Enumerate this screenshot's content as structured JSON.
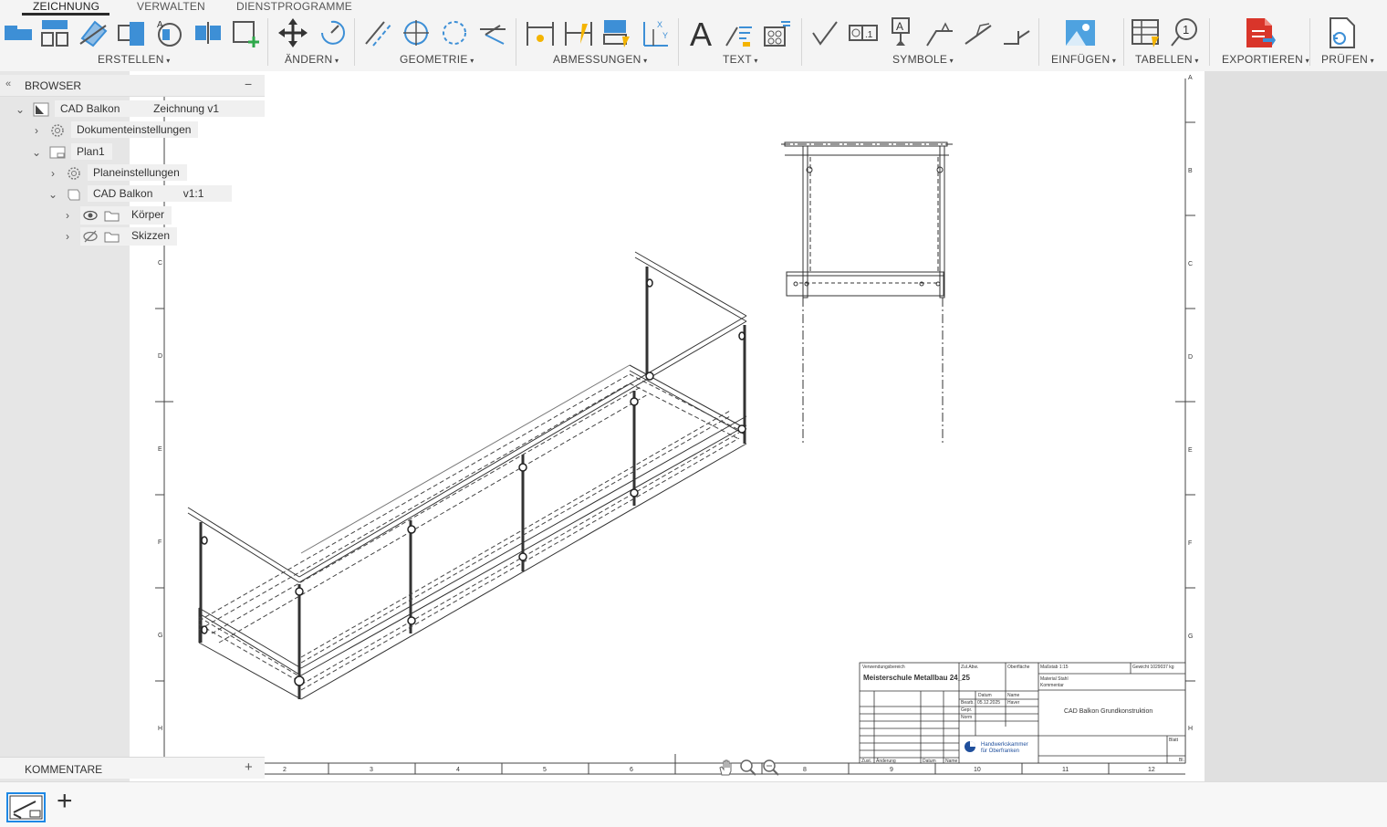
{
  "tabs": {
    "zeichnung": "ZEICHNUNG",
    "verwalten": "VERWALTEN",
    "dienstprogramme": "DIENSTPROGRAMME"
  },
  "groups": {
    "erstellen": "ERSTELLEN",
    "aendern": "ÄNDERN",
    "geometrie": "GEOMETRIE",
    "abmessungen": "ABMESSUNGEN",
    "text": "TEXT",
    "symbole": "SYMBOLE",
    "einfuegen": "EINFÜGEN",
    "tabellen": "TABELLEN",
    "exportieren": "EXPORTIEREN",
    "pruefen": "PRÜFEN"
  },
  "browser": {
    "title": "BROWSER",
    "collapse": "«",
    "minimize": "−",
    "items": [
      {
        "label": "CAD Balkon",
        "suffix": "Zeichnung v1"
      },
      {
        "label": "Dokumenteinstellungen"
      },
      {
        "label": "Plan1"
      },
      {
        "label": "Planeinstellungen"
      },
      {
        "label": "CAD Balkon",
        "suffix": "v1:1"
      },
      {
        "label": "Körper"
      },
      {
        "label": "Skizzen"
      }
    ]
  },
  "comments": {
    "label": "KOMMENTARE",
    "add": "+"
  },
  "sheet": {
    "col_labels": [
      "2",
      "3",
      "4",
      "5",
      "6",
      "8",
      "9",
      "10",
      "11",
      "12"
    ],
    "row_labels_left": [
      "C",
      "D",
      "E",
      "F",
      "G",
      "H"
    ],
    "row_labels_right": [
      "A",
      "B",
      "C",
      "D",
      "E",
      "F",
      "G",
      "H"
    ]
  },
  "title_block": {
    "verwendungsbereich": "Verwendungsbereich",
    "project": "Meisterschule Metallbau 24_25",
    "zulbw": "Zul.Abw.",
    "oberflaeche": "Oberfläche",
    "massstab": "Maßstab 1:15",
    "gewicht": "Gewicht 1029037 kg",
    "material": "Material Stahl",
    "kommentar": "Kommentar",
    "datum": "Datum",
    "name": "Name",
    "bearb": "Bearb.",
    "bearb_datum": "05.12.2025",
    "bearb_name": "Haver",
    "gepr": "Gepr.",
    "norm": "Norm",
    "drawing_title": "CAD Balkon Grundkonstruktion",
    "org_line1": "Handwerkskammer",
    "org_line2": "für Oberfranken",
    "blatt": "Blatt",
    "bl": "Bl.",
    "zust": "Zust.",
    "aenderung": "Änderung",
    "datum2": "Datum",
    "name2": "Name"
  },
  "nav_icons": [
    "pan-icon",
    "zoom-icon",
    "zoom-window-icon"
  ],
  "bottom": {
    "add": "+"
  },
  "colors": {
    "ribbon_bg": "#f4f4f4",
    "accent_blue": "#3d8fd6",
    "export_red": "#d9352a",
    "sheet_gray": "#e0e0e0",
    "line": "#3a3a3a"
  }
}
